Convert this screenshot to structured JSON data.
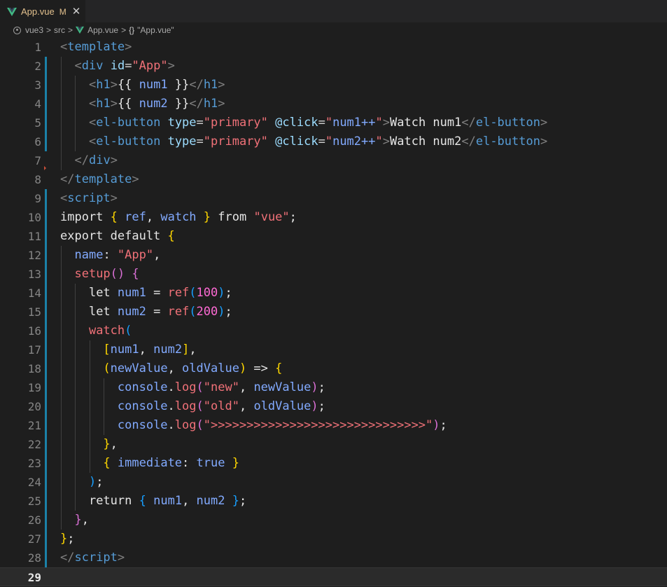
{
  "tab": {
    "title": "App.vue",
    "modified": "M",
    "close": "✕",
    "icon": "vue-icon"
  },
  "breadcrumb": {
    "folder": "vue3",
    "sub": "src",
    "file": "App.vue",
    "symbol": "\"App.vue\"",
    "braces": "{}",
    "sep": ">"
  },
  "colors": {
    "tag": "#569cd6",
    "attr": "#9cdcfe",
    "string": "#f07178",
    "number": "#ff6ad5",
    "bracket1": "#ffd700",
    "bracket2": "#da70d6",
    "bracket3": "#179fff",
    "variable": "#82aaff",
    "gutter_change": "#1b81a8",
    "background": "#1e1e1e"
  },
  "current_line": 29,
  "lines": [
    {
      "n": "1",
      "tokens": [
        [
          "<",
          "punc"
        ],
        [
          "template",
          "tag"
        ],
        [
          ">",
          "punc"
        ]
      ]
    },
    {
      "n": "2",
      "tokens": [
        [
          "  ",
          "plain"
        ],
        [
          "<",
          "punc"
        ],
        [
          "div",
          "tag"
        ],
        [
          " ",
          "plain"
        ],
        [
          "id",
          "attr"
        ],
        [
          "=",
          "plain"
        ],
        [
          "\"App\"",
          "str"
        ],
        [
          ">",
          "punc"
        ]
      ]
    },
    {
      "n": "3",
      "tokens": [
        [
          "    ",
          "plain"
        ],
        [
          "<",
          "punc"
        ],
        [
          "h1",
          "tag"
        ],
        [
          ">",
          "punc"
        ],
        [
          "{{ ",
          "white"
        ],
        [
          "num1",
          "var"
        ],
        [
          " }}",
          "white"
        ],
        [
          "</",
          "punc"
        ],
        [
          "h1",
          "tag"
        ],
        [
          ">",
          "punc"
        ]
      ]
    },
    {
      "n": "4",
      "tokens": [
        [
          "    ",
          "plain"
        ],
        [
          "<",
          "punc"
        ],
        [
          "h1",
          "tag"
        ],
        [
          ">",
          "punc"
        ],
        [
          "{{ ",
          "white"
        ],
        [
          "num2",
          "var"
        ],
        [
          " }}",
          "white"
        ],
        [
          "</",
          "punc"
        ],
        [
          "h1",
          "tag"
        ],
        [
          ">",
          "punc"
        ]
      ]
    },
    {
      "n": "5",
      "tokens": [
        [
          "    ",
          "plain"
        ],
        [
          "<",
          "punc"
        ],
        [
          "el-button",
          "tag"
        ],
        [
          " ",
          "plain"
        ],
        [
          "type",
          "attr"
        ],
        [
          "=",
          "plain"
        ],
        [
          "\"primary\"",
          "str"
        ],
        [
          " ",
          "plain"
        ],
        [
          "@click",
          "attr"
        ],
        [
          "=",
          "plain"
        ],
        [
          "\"",
          "str"
        ],
        [
          "num1++",
          "var"
        ],
        [
          "\"",
          "str"
        ],
        [
          ">",
          "punc"
        ],
        [
          "Watch num1",
          "white"
        ],
        [
          "</",
          "punc"
        ],
        [
          "el-button",
          "tag"
        ],
        [
          ">",
          "punc"
        ]
      ]
    },
    {
      "n": "6",
      "tokens": [
        [
          "    ",
          "plain"
        ],
        [
          "<",
          "punc"
        ],
        [
          "el-button",
          "tag"
        ],
        [
          " ",
          "plain"
        ],
        [
          "type",
          "attr"
        ],
        [
          "=",
          "plain"
        ],
        [
          "\"primary\"",
          "str"
        ],
        [
          " ",
          "plain"
        ],
        [
          "@click",
          "attr"
        ],
        [
          "=",
          "plain"
        ],
        [
          "\"",
          "str"
        ],
        [
          "num2++",
          "var"
        ],
        [
          "\"",
          "str"
        ],
        [
          ">",
          "punc"
        ],
        [
          "Watch num2",
          "white"
        ],
        [
          "</",
          "punc"
        ],
        [
          "el-button",
          "tag"
        ],
        [
          ">",
          "punc"
        ]
      ]
    },
    {
      "n": "7",
      "tokens": [
        [
          "  ",
          "plain"
        ],
        [
          "</",
          "punc"
        ],
        [
          "div",
          "tag"
        ],
        [
          ">",
          "punc"
        ]
      ]
    },
    {
      "n": "8",
      "tokens": [
        [
          "</",
          "punc"
        ],
        [
          "template",
          "tag"
        ],
        [
          ">",
          "punc"
        ]
      ]
    },
    {
      "n": "9",
      "tokens": [
        [
          "<",
          "punc"
        ],
        [
          "script",
          "tag"
        ],
        [
          ">",
          "punc"
        ]
      ]
    },
    {
      "n": "10",
      "tokens": [
        [
          "import ",
          "kw"
        ],
        [
          "{",
          "b1"
        ],
        [
          " ",
          "plain"
        ],
        [
          "ref",
          "var"
        ],
        [
          ", ",
          "white"
        ],
        [
          "watch",
          "var"
        ],
        [
          " ",
          "plain"
        ],
        [
          "}",
          "b1"
        ],
        [
          " from ",
          "kw"
        ],
        [
          "\"vue\"",
          "str"
        ],
        [
          ";",
          "white"
        ]
      ]
    },
    {
      "n": "11",
      "tokens": [
        [
          "export default ",
          "kw"
        ],
        [
          "{",
          "b1"
        ]
      ]
    },
    {
      "n": "12",
      "tokens": [
        [
          "  ",
          "plain"
        ],
        [
          "name",
          "prop"
        ],
        [
          ": ",
          "white"
        ],
        [
          "\"App\"",
          "str"
        ],
        [
          ",",
          "white"
        ]
      ]
    },
    {
      "n": "13",
      "tokens": [
        [
          "  ",
          "plain"
        ],
        [
          "setup",
          "fn"
        ],
        [
          "()",
          "b2"
        ],
        [
          " ",
          "plain"
        ],
        [
          "{",
          "b2"
        ]
      ]
    },
    {
      "n": "14",
      "tokens": [
        [
          "    ",
          "plain"
        ],
        [
          "let ",
          "kw"
        ],
        [
          "num1",
          "var"
        ],
        [
          " = ",
          "white"
        ],
        [
          "ref",
          "fn"
        ],
        [
          "(",
          "b3"
        ],
        [
          "100",
          "num"
        ],
        [
          ")",
          "b3"
        ],
        [
          ";",
          "white"
        ]
      ]
    },
    {
      "n": "15",
      "tokens": [
        [
          "    ",
          "plain"
        ],
        [
          "let ",
          "kw"
        ],
        [
          "num2",
          "var"
        ],
        [
          " = ",
          "white"
        ],
        [
          "ref",
          "fn"
        ],
        [
          "(",
          "b3"
        ],
        [
          "200",
          "num"
        ],
        [
          ")",
          "b3"
        ],
        [
          ";",
          "white"
        ]
      ]
    },
    {
      "n": "16",
      "tokens": [
        [
          "    ",
          "plain"
        ],
        [
          "watch",
          "fn"
        ],
        [
          "(",
          "b3"
        ]
      ]
    },
    {
      "n": "17",
      "tokens": [
        [
          "      ",
          "plain"
        ],
        [
          "[",
          "b1"
        ],
        [
          "num1",
          "var"
        ],
        [
          ", ",
          "white"
        ],
        [
          "num2",
          "var"
        ],
        [
          "]",
          "b1"
        ],
        [
          ",",
          "white"
        ]
      ]
    },
    {
      "n": "18",
      "tokens": [
        [
          "      ",
          "plain"
        ],
        [
          "(",
          "b1"
        ],
        [
          "newValue",
          "var"
        ],
        [
          ", ",
          "white"
        ],
        [
          "oldValue",
          "var"
        ],
        [
          ")",
          "b1"
        ],
        [
          " => ",
          "white"
        ],
        [
          "{",
          "b1"
        ]
      ]
    },
    {
      "n": "19",
      "tokens": [
        [
          "        ",
          "plain"
        ],
        [
          "console",
          "var"
        ],
        [
          ".",
          "white"
        ],
        [
          "log",
          "fn"
        ],
        [
          "(",
          "b2"
        ],
        [
          "\"new\"",
          "str"
        ],
        [
          ", ",
          "white"
        ],
        [
          "newValue",
          "var"
        ],
        [
          ")",
          "b2"
        ],
        [
          ";",
          "white"
        ]
      ]
    },
    {
      "n": "20",
      "tokens": [
        [
          "        ",
          "plain"
        ],
        [
          "console",
          "var"
        ],
        [
          ".",
          "white"
        ],
        [
          "log",
          "fn"
        ],
        [
          "(",
          "b2"
        ],
        [
          "\"old\"",
          "str"
        ],
        [
          ", ",
          "white"
        ],
        [
          "oldValue",
          "var"
        ],
        [
          ")",
          "b2"
        ],
        [
          ";",
          "white"
        ]
      ]
    },
    {
      "n": "21",
      "tokens": [
        [
          "        ",
          "plain"
        ],
        [
          "console",
          "var"
        ],
        [
          ".",
          "white"
        ],
        [
          "log",
          "fn"
        ],
        [
          "(",
          "b2"
        ],
        [
          "\">>>>>>>>>>>>>>>>>>>>>>>>>>>>>>\"",
          "str"
        ],
        [
          ")",
          "b2"
        ],
        [
          ";",
          "white"
        ]
      ]
    },
    {
      "n": "22",
      "tokens": [
        [
          "      ",
          "plain"
        ],
        [
          "}",
          "b1"
        ],
        [
          ",",
          "white"
        ]
      ]
    },
    {
      "n": "23",
      "tokens": [
        [
          "      ",
          "plain"
        ],
        [
          "{",
          "b1"
        ],
        [
          " ",
          "plain"
        ],
        [
          "immediate",
          "prop"
        ],
        [
          ": ",
          "white"
        ],
        [
          "true",
          "bool"
        ],
        [
          " ",
          "plain"
        ],
        [
          "}",
          "b1"
        ]
      ]
    },
    {
      "n": "24",
      "tokens": [
        [
          "    ",
          "plain"
        ],
        [
          ")",
          "b3"
        ],
        [
          ";",
          "white"
        ]
      ]
    },
    {
      "n": "25",
      "tokens": [
        [
          "    ",
          "plain"
        ],
        [
          "return ",
          "kw"
        ],
        [
          "{",
          "b3"
        ],
        [
          " ",
          "plain"
        ],
        [
          "num1",
          "var"
        ],
        [
          ", ",
          "white"
        ],
        [
          "num2",
          "var"
        ],
        [
          " ",
          "plain"
        ],
        [
          "}",
          "b3"
        ],
        [
          ";",
          "white"
        ]
      ]
    },
    {
      "n": "26",
      "tokens": [
        [
          "  ",
          "plain"
        ],
        [
          "}",
          "b2"
        ],
        [
          ",",
          "white"
        ]
      ]
    },
    {
      "n": "27",
      "tokens": [
        [
          "}",
          "b1"
        ],
        [
          ";",
          "white"
        ]
      ]
    },
    {
      "n": "28",
      "tokens": [
        [
          "</",
          "punc"
        ],
        [
          "script",
          "tag"
        ],
        [
          ">",
          "punc"
        ]
      ]
    },
    {
      "n": "29",
      "tokens": []
    }
  ]
}
